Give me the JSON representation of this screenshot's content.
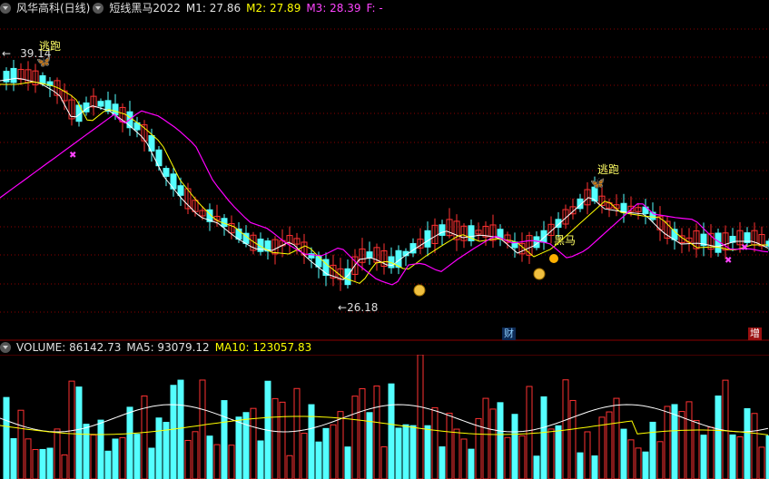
{
  "header": {
    "stock_name": "风华高科(日线)",
    "indicator_name": "短线黑马2022",
    "m1": "M1: 27.86",
    "m2": "M2: 27.89",
    "m3": "M3: 28.39",
    "f": "F: -"
  },
  "price_panel": {
    "high_label": "39.14",
    "low_label": "26.18",
    "signal_escape_1": "逃跑",
    "signal_escape_2": "逃跑",
    "signal_dark_horse": "黑马",
    "badge_finance": "财",
    "badge_increase": "增"
  },
  "volume_header": {
    "volume": "VOLUME: 86142.73",
    "ma5": "MA5: 93079.12",
    "ma10": "MA10: 123057.83"
  },
  "colors": {
    "up": "#ff3232",
    "down": "#54ffff",
    "ma_yellow": "#ffff00",
    "ma_magenta": "#ff00ff",
    "ma_white": "#ffffff",
    "grid": "#8b0000",
    "m2_color": "#ffff00",
    "m3_color": "#ff00ff"
  }
}
